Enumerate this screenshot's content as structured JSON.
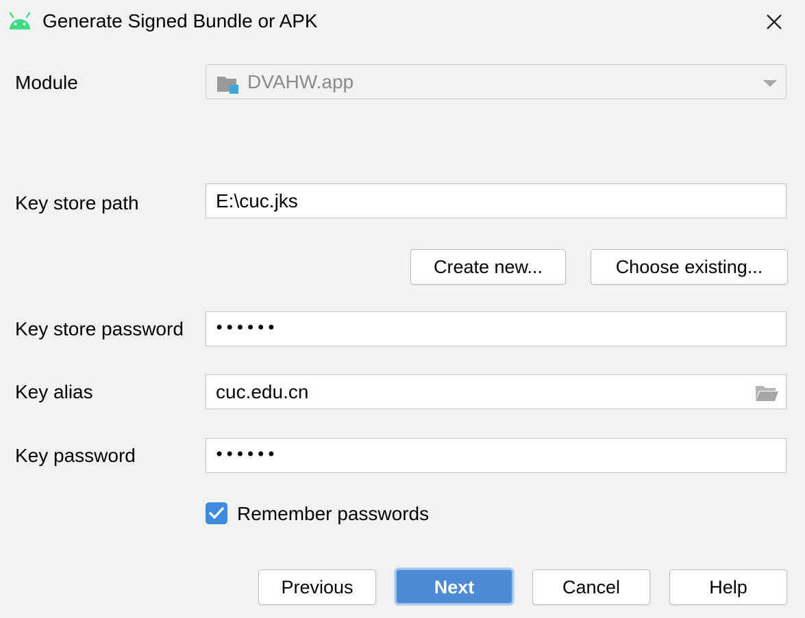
{
  "window": {
    "title": "Generate Signed Bundle or APK",
    "icon": "android-icon",
    "accent_color": "#3ddc84"
  },
  "module": {
    "label": "Module",
    "value": "DVAHW.app"
  },
  "keystore": {
    "path_label": "Key store path",
    "path_value": "E:\\cuc.jks",
    "create_new_label": "Create new...",
    "choose_existing_label": "Choose existing...",
    "password_label": "Key store password",
    "password_mask": "••••••"
  },
  "key": {
    "alias_label": "Key alias",
    "alias_value": "cuc.edu.cn",
    "password_label": "Key password",
    "password_mask": "••••••"
  },
  "remember": {
    "label": "Remember passwords",
    "checked": true
  },
  "footer": {
    "previous_label": "Previous",
    "next_label": "Next",
    "cancel_label": "Cancel",
    "help_label": "Help"
  },
  "colors": {
    "primary_button": "#4d8bd6",
    "checkbox": "#3f8cdf",
    "background": "#f2f2f2"
  }
}
